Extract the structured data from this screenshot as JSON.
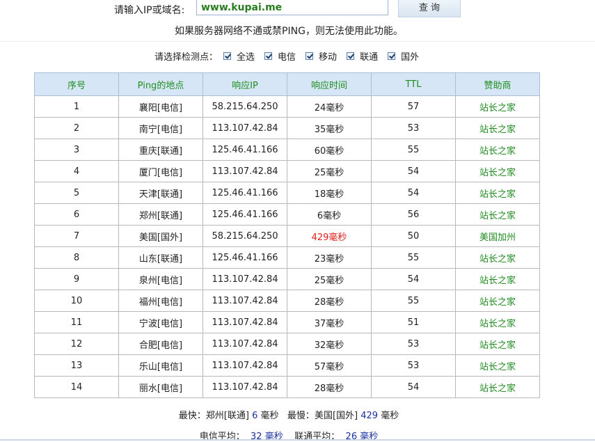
{
  "query": {
    "label": "请输入IP或域名:",
    "input_value": "www.kupai.me",
    "button_label": "查 询"
  },
  "notice": "如果服务器网络不通或禁PING，则无法使用此功能。",
  "points": {
    "label": "请选择检测点：",
    "options": [
      {
        "label": "全选",
        "checked": true
      },
      {
        "label": "电信",
        "checked": true
      },
      {
        "label": "移动",
        "checked": true
      },
      {
        "label": "联通",
        "checked": true
      },
      {
        "label": "国外",
        "checked": true
      }
    ]
  },
  "table": {
    "headers": [
      "序号",
      "Ping的地点",
      "响应IP",
      "响应时间",
      "TTL",
      "赞助商"
    ],
    "rows": [
      [
        "1",
        "襄阳[电信]",
        "58.215.64.250",
        "24毫秒",
        "57",
        "站长之家"
      ],
      [
        "2",
        "南宁[电信]",
        "113.107.42.84",
        "35毫秒",
        "53",
        "站长之家"
      ],
      [
        "3",
        "重庆[联通]",
        "125.46.41.166",
        "60毫秒",
        "55",
        "站长之家"
      ],
      [
        "4",
        "厦门[电信]",
        "113.107.42.84",
        "25毫秒",
        "54",
        "站长之家"
      ],
      [
        "5",
        "天津[联通]",
        "125.46.41.166",
        "18毫秒",
        "54",
        "站长之家"
      ],
      [
        "6",
        "郑州[联通]",
        "125.46.41.166",
        "6毫秒",
        "56",
        "站长之家"
      ],
      [
        "7",
        "美国[国外]",
        "58.215.64.250",
        "429毫秒",
        "50",
        "美国加州"
      ],
      [
        "8",
        "山东[联通]",
        "125.46.41.166",
        "23毫秒",
        "55",
        "站长之家"
      ],
      [
        "9",
        "泉州[电信]",
        "113.107.42.84",
        "25毫秒",
        "54",
        "站长之家"
      ],
      [
        "10",
        "福州[电信]",
        "113.107.42.84",
        "28毫秒",
        "55",
        "站长之家"
      ],
      [
        "11",
        "宁波[电信]",
        "113.107.42.84",
        "37毫秒",
        "51",
        "站长之家"
      ],
      [
        "12",
        "合肥[电信]",
        "113.107.42.84",
        "32毫秒",
        "53",
        "站长之家"
      ],
      [
        "13",
        "乐山[电信]",
        "113.107.42.84",
        "57毫秒",
        "53",
        "站长之家"
      ],
      [
        "14",
        "丽水[电信]",
        "113.107.42.84",
        "28毫秒",
        "54",
        "站长之家"
      ]
    ],
    "slow_row_index": 6
  },
  "summary": {
    "fastest_label": "最快：",
    "fastest_location": "郑州[联通]",
    "fastest_value": "6",
    "slowest_label": "最慢：",
    "slowest_location": "美国[国外]",
    "slowest_value": "429",
    "unit": "毫秒"
  },
  "averages": {
    "telecom_label": "电信平均：",
    "telecom_value": "32",
    "unicom_label": "联通平均：",
    "unicom_value": "26",
    "unit": "毫秒"
  }
}
